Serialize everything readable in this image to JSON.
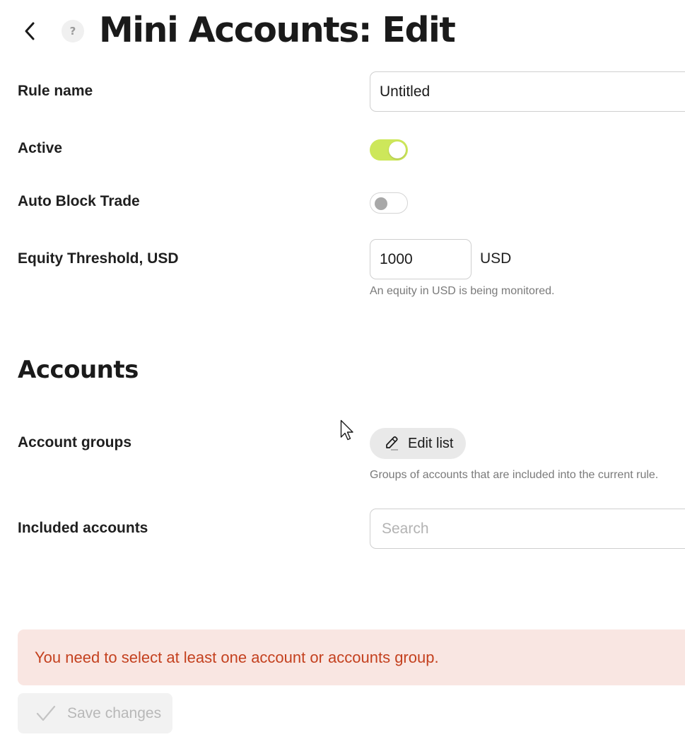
{
  "header": {
    "title": "Mini Accounts: Edit",
    "help_label": "?",
    "back_icon": "chevron-left-icon"
  },
  "form": {
    "rule_name": {
      "label": "Rule name",
      "value": "Untitled"
    },
    "active": {
      "label": "Active",
      "enabled": true
    },
    "auto_block_trade": {
      "label": "Auto Block Trade",
      "enabled": false
    },
    "equity_threshold": {
      "label": "Equity Threshold, USD",
      "value": "1000",
      "unit": "USD",
      "hint": "An equity in USD is being monitored."
    }
  },
  "accounts": {
    "section_title": "Accounts",
    "account_groups": {
      "label": "Account groups",
      "button_label": "Edit list",
      "hint": "Groups of accounts that are included into the current rule."
    },
    "included_accounts": {
      "label": "Included accounts",
      "placeholder": "Search"
    }
  },
  "error_message": "You need to select at least one account or accounts group.",
  "save_button_label": "Save changes",
  "colors": {
    "toggle_on": "#cde75a",
    "error_bg": "#f9e6e2",
    "error_text": "#c4411f"
  }
}
